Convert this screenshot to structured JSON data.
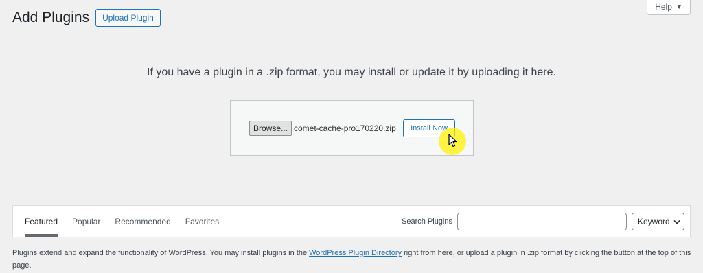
{
  "header": {
    "title": "Add Plugins",
    "upload_button": "Upload Plugin",
    "help_label": "Help",
    "help_arrow": "▼"
  },
  "upload": {
    "instructions": "If you have a plugin in a .zip format, you may install or update it by uploading it here.",
    "browse_label": "Browse...",
    "file_name": "comet-cache-pro170220.zip",
    "install_label": "Install Now"
  },
  "filter": {
    "tabs": [
      "Featured",
      "Popular",
      "Recommended",
      "Favorites"
    ],
    "current_tab": "Featured",
    "search_label": "Search Plugins",
    "search_value": "",
    "search_type": "Keyword"
  },
  "description": {
    "before_link": "Plugins extend and expand the functionality of WordPress. You may install plugins in the ",
    "link_text": "WordPress Plugin Directory",
    "after_link": " right from here, or upload a plugin in .zip format by clicking the button at the top of this page."
  },
  "colors": {
    "accent": "#2271b1",
    "background": "#f0f0f1",
    "cursor_highlight": "#fff000"
  }
}
